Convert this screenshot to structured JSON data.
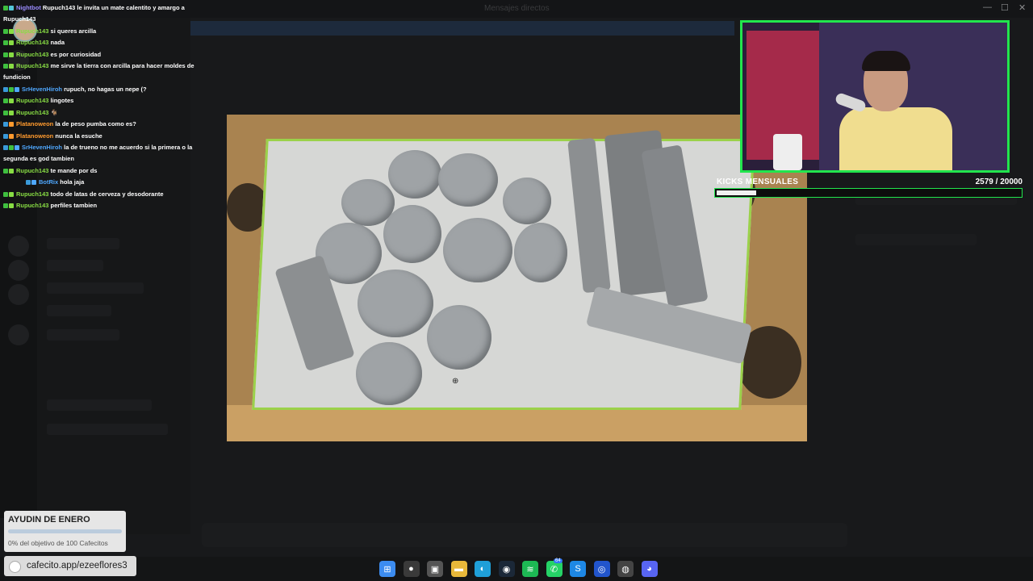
{
  "window": {
    "title": "Mensajes directos",
    "minimize": "—",
    "maximize": "☐",
    "close": "✕"
  },
  "chat": {
    "messages": [
      {
        "user": "Nightbot",
        "color": "#9b8cff",
        "text": "Rupuch143 le invita un mate calentito y amargo a Rupuch143",
        "badges": [
          "#3fbf3f",
          "#54c6d8"
        ]
      },
      {
        "user": "Rupuch143",
        "color": "#88dd44",
        "text": "si queres arcilla",
        "badges": [
          "#3fbf3f",
          "#88dd44"
        ]
      },
      {
        "user": "Rupuch143",
        "color": "#88dd44",
        "text": "nada",
        "badges": [
          "#3fbf3f",
          "#88dd44"
        ]
      },
      {
        "user": "Rupuch143",
        "color": "#88dd44",
        "text": "es por curiosidad",
        "badges": [
          "#3fbf3f",
          "#88dd44"
        ]
      },
      {
        "user": "Rupuch143",
        "color": "#88dd44",
        "text": "me sirve la tierra con arcilla para hacer moldes de fundicion",
        "badges": [
          "#3fbf3f",
          "#88dd44"
        ]
      },
      {
        "user": "SrHevenHiroh",
        "color": "#4fa8ff",
        "text": "rupuch, no hagas un nepe (?",
        "badges": [
          "#3a9ad9",
          "#3fbf3f",
          "#4fa8ff"
        ]
      },
      {
        "user": "Rupuch143",
        "color": "#88dd44",
        "text": "lingotes",
        "badges": [
          "#3fbf3f",
          "#88dd44"
        ]
      },
      {
        "user": "Rupuch143",
        "color": "#88dd44",
        "text": "🐐",
        "badges": [
          "#3fbf3f",
          "#88dd44"
        ]
      },
      {
        "user": "Platanoweon",
        "color": "#ff9a2e",
        "text": "la de peso pumba como es?",
        "badges": [
          "#3a9ad9",
          "#ff9a2e"
        ]
      },
      {
        "user": "Platanoweon",
        "color": "#ff9a2e",
        "text": "nunca la esuche",
        "badges": [
          "#3a9ad9",
          "#ff9a2e"
        ]
      },
      {
        "user": "SrHevenHiroh",
        "color": "#4fa8ff",
        "text": "la de trueno no me acuerdo si la primera o la segunda es god tambien",
        "badges": [
          "#3a9ad9",
          "#3fbf3f",
          "#4fa8ff"
        ]
      },
      {
        "user": "Rupuch143",
        "color": "#88dd44",
        "text": "te mande por ds",
        "badges": [
          "#3fbf3f",
          "#88dd44"
        ]
      },
      {
        "user": "BotRix",
        "color": "#4fa8ff",
        "text": "hola jaja",
        "badges": [
          "#3a9ad9",
          "#4fa8ff"
        ],
        "indent": true
      },
      {
        "user": "Rupuch143",
        "color": "#88dd44",
        "text": "todo de latas de cerveza y desodorante",
        "badges": [
          "#3fbf3f",
          "#88dd44"
        ]
      },
      {
        "user": "Rupuch143",
        "color": "#88dd44",
        "text": "perfiles tambien",
        "badges": [
          "#3fbf3f",
          "#88dd44"
        ]
      }
    ]
  },
  "kicks": {
    "label": "KICKS MENSUALES",
    "count": "2579  / 20000",
    "progress": 0.129
  },
  "goal": {
    "title": "AYUDIN DE ENERO",
    "subtitle": "0% del objetivo de 100 Cafecitos",
    "progress": 0
  },
  "url": {
    "text": "cafecito.app/ezeeflores3"
  },
  "taskbar": {
    "items": [
      {
        "name": "windows-start-icon",
        "glyph": "⊞",
        "color": "#3c8cf0"
      },
      {
        "name": "search-icon",
        "glyph": "●",
        "color": "#3a3a3a"
      },
      {
        "name": "task-view-icon",
        "glyph": "▣",
        "color": "#555"
      },
      {
        "name": "file-explorer-icon",
        "glyph": "▬",
        "color": "#e8b83a"
      },
      {
        "name": "edge-browser-icon",
        "glyph": "◐",
        "color": "#1f9fd8"
      },
      {
        "name": "steam-icon",
        "glyph": "◉",
        "color": "#1b2838"
      },
      {
        "name": "spotify-icon",
        "glyph": "≋",
        "color": "#1db954"
      },
      {
        "name": "whatsapp-icon",
        "glyph": "✆",
        "color": "#25d366"
      },
      {
        "name": "skype-icon",
        "glyph": "S",
        "color": "#1e88e5"
      },
      {
        "name": "obs-web-icon",
        "glyph": "◎",
        "color": "#2255cc"
      },
      {
        "name": "obs-studio-icon",
        "glyph": "◍",
        "color": "#444"
      },
      {
        "name": "discord-icon",
        "glyph": "◕",
        "color": "#5865f2"
      }
    ],
    "whatsapp_badge": "64"
  }
}
